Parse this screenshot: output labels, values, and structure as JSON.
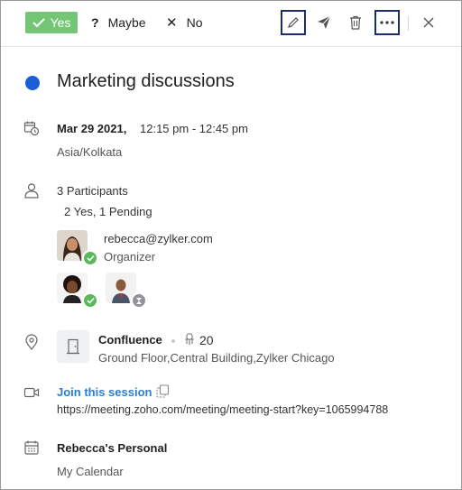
{
  "toolbar": {
    "yes_label": "Yes",
    "maybe_label": "Maybe",
    "no_label": "No",
    "maybe_glyph": "?",
    "no_glyph": "✕",
    "accent_yes": "#74c676",
    "outline_color": "#1c2d6f"
  },
  "event": {
    "title": "Marketing discussions",
    "color": "#1a5fd6",
    "date": "Mar 29 2021,",
    "time": "12:15 pm - 12:45 pm",
    "timezone": "Asia/Kolkata"
  },
  "participants": {
    "count_label": "3 Participants",
    "summary": "2 Yes, 1 Pending",
    "organizer_email": "rebecca@zylker.com",
    "organizer_role": "Organizer"
  },
  "location": {
    "room": "Confluence",
    "capacity": "20",
    "address": "Ground Floor,Central Building,Zylker Chicago"
  },
  "meeting": {
    "join_label": "Join this session",
    "url": "https://meeting.zoho.com/meeting/meeting-start?key=1065994788"
  },
  "calendar": {
    "name": "Rebecca's Personal",
    "type": "My Calendar"
  },
  "icons": [
    "check-icon",
    "edit-icon",
    "send-icon",
    "trash-icon",
    "more-icon",
    "close-icon",
    "calendar-clock-icon",
    "person-icon",
    "location-pin-icon",
    "door-icon",
    "seat-icon",
    "video-icon",
    "copy-icon",
    "calendar-icon"
  ]
}
